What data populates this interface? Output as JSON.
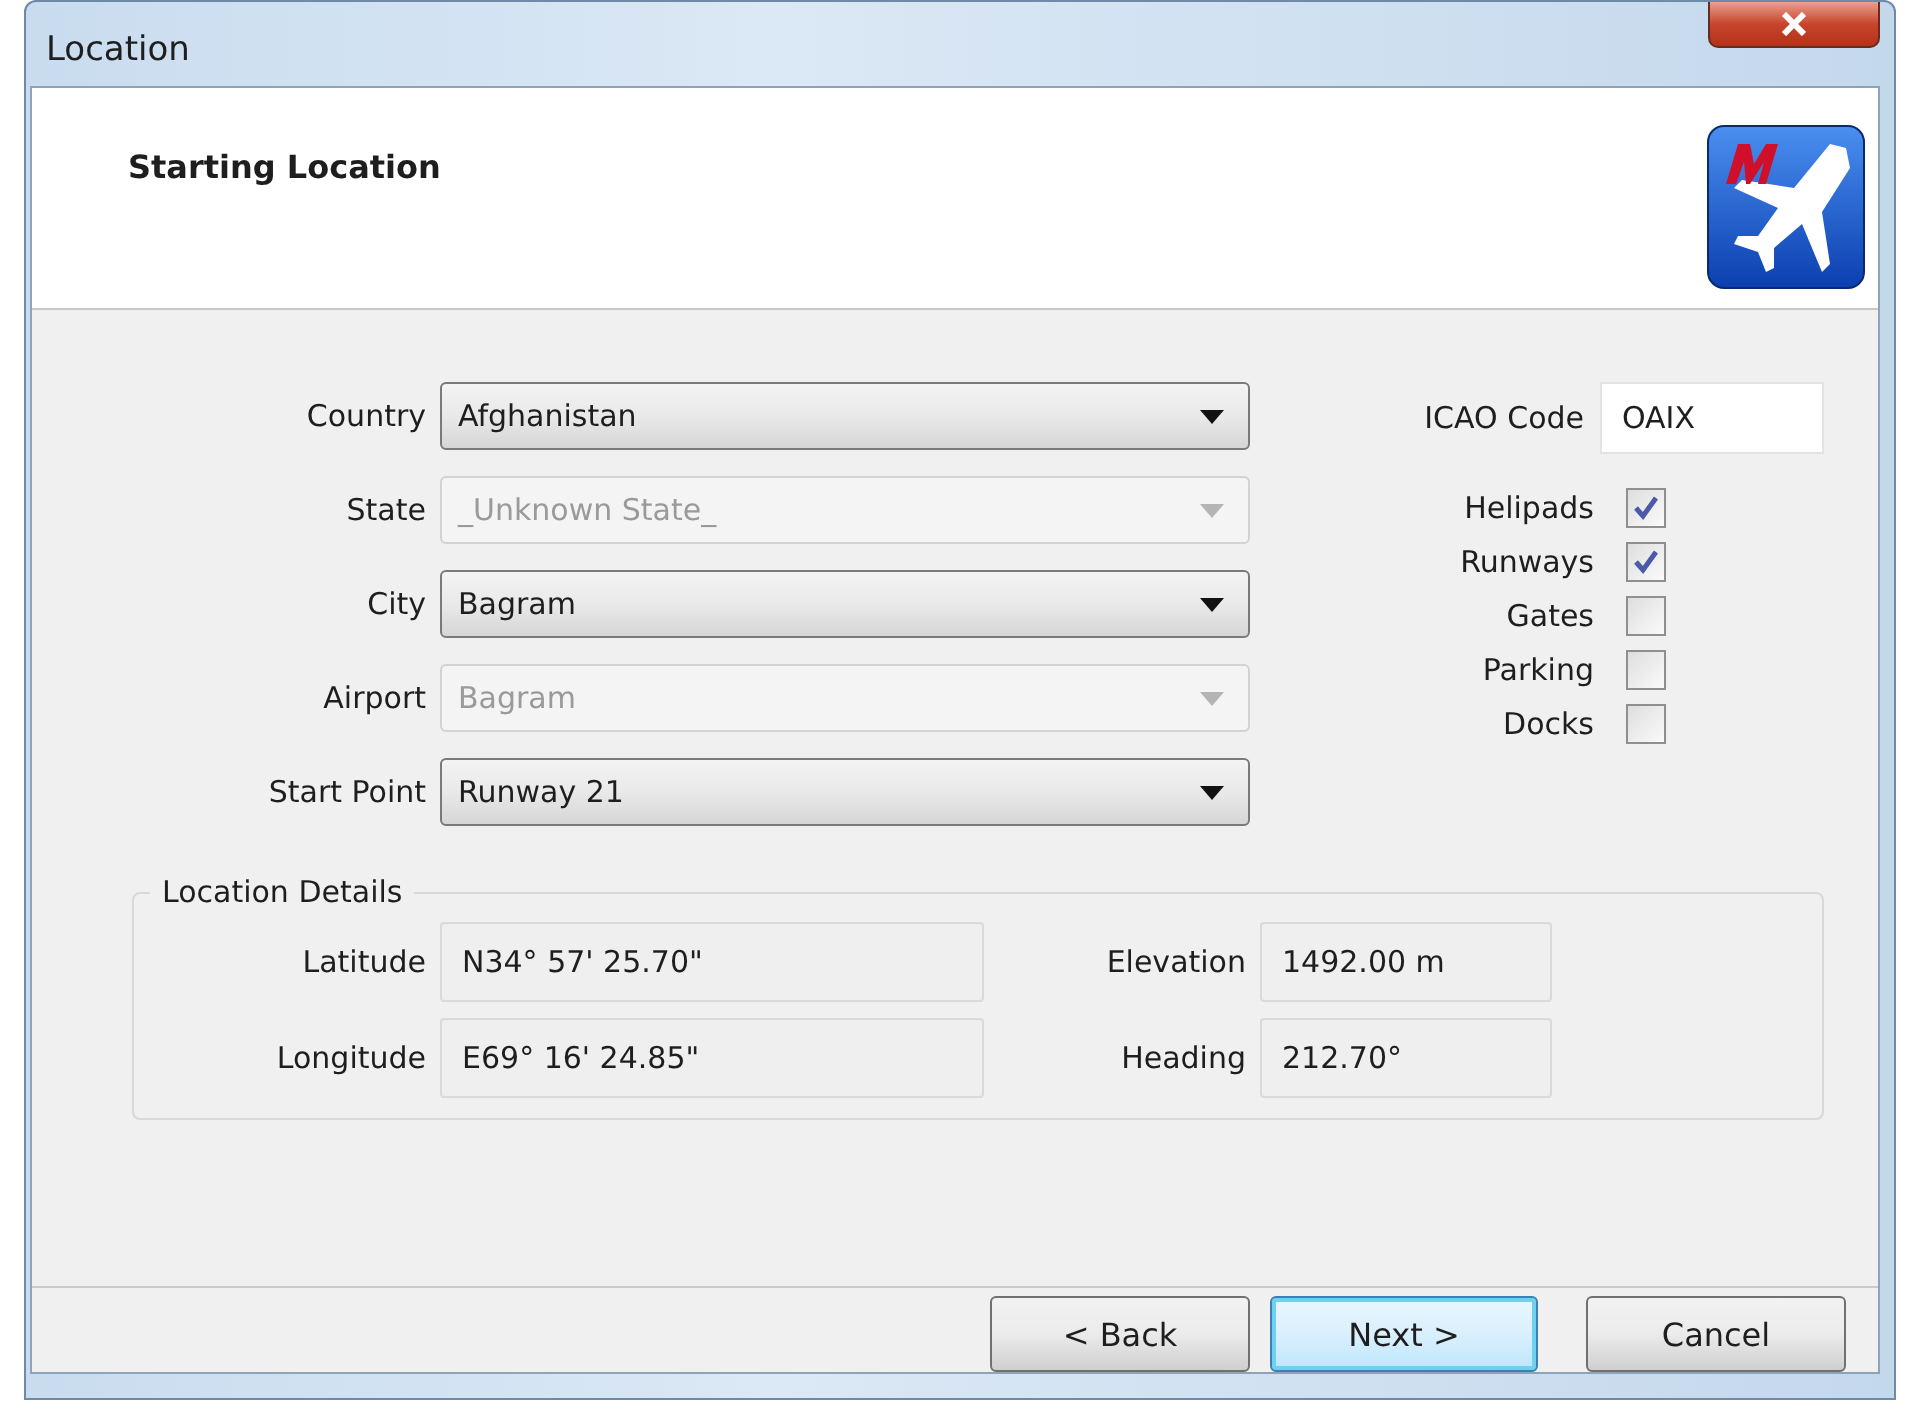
{
  "window": {
    "title": "Location"
  },
  "header": {
    "title": "Starting Location"
  },
  "combos": [
    {
      "label": "Country",
      "value": "Afghanistan",
      "disabled": false
    },
    {
      "label": "State",
      "value": "_Unknown State_",
      "disabled": true
    },
    {
      "label": "City",
      "value": "Bagram",
      "disabled": false
    },
    {
      "label": "Airport",
      "value": "Bagram",
      "disabled": true
    },
    {
      "label": "Start Point",
      "value": "Runway 21",
      "disabled": false
    }
  ],
  "icao": {
    "label": "ICAO Code",
    "value": "OAIX"
  },
  "filters": [
    {
      "label": "Helipads",
      "checked": true
    },
    {
      "label": "Runways",
      "checked": true
    },
    {
      "label": "Gates",
      "checked": false
    },
    {
      "label": "Parking",
      "checked": false
    },
    {
      "label": "Docks",
      "checked": false
    }
  ],
  "details": {
    "title": "Location Details",
    "left": [
      {
        "label": "Latitude",
        "value": "N34° 57' 25.70\""
      },
      {
        "label": "Longitude",
        "value": "E69° 16' 24.85\""
      }
    ],
    "right": [
      {
        "label": "Elevation",
        "value": "1492.00 m"
      },
      {
        "label": "Heading",
        "value": "212.70°"
      }
    ]
  },
  "buttons": [
    {
      "label": "< Back",
      "default": false
    },
    {
      "label": "Next >",
      "default": true
    },
    {
      "label": "Cancel",
      "default": false
    }
  ]
}
